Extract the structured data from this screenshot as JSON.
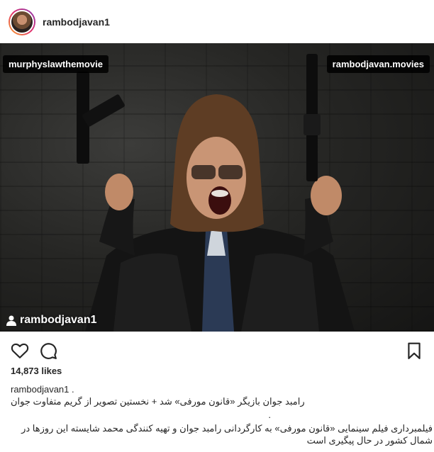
{
  "post": {
    "username": "rambodjavan1",
    "image_tags": {
      "left": "murphyslawthemovie",
      "right": "rambodjavan.movies"
    },
    "watermark": "rambodjavan1",
    "likes": "14,873 likes",
    "caption": {
      "username": "rambodjavan1 .",
      "line1": "رامبد جوان بازیگر «قانون مورفی» شد + نخستین تصویر از گریم متفاوت جوان",
      "line2": ".",
      "line3": "فیلمبرداری فیلم سینمایی «قانون مورفی» به کارگردانی رامبد جوان و تهیه کنندگی محمد شایسته این روزها در شمال کشور در حال پیگیری است"
    }
  },
  "icons": {
    "like": "heart-icon",
    "comment": "comment-icon",
    "save": "bookmark-icon",
    "watermark": "user-icon"
  }
}
